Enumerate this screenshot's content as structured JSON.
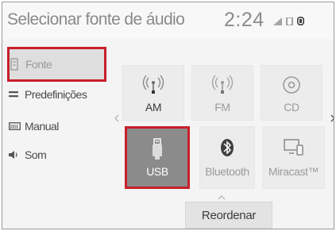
{
  "header": {
    "title": "Selecionar fonte de áudio",
    "clock": "2:24"
  },
  "sidebar": {
    "items": [
      {
        "label": "Fonte",
        "icon": "source-icon",
        "selected": true
      },
      {
        "label": "Predefinições",
        "icon": "presets-icon",
        "selected": false
      },
      {
        "label": "Manual",
        "icon": "manual-icon",
        "selected": false
      },
      {
        "label": "Som",
        "icon": "speaker-icon",
        "selected": false
      }
    ]
  },
  "sources": [
    {
      "label": "AM",
      "icon": "radio-wave-icon",
      "active": true
    },
    {
      "label": "FM",
      "icon": "radio-wave-icon",
      "active": false
    },
    {
      "label": "CD",
      "icon": "disc-icon",
      "active": false
    },
    {
      "label": "USB",
      "icon": "usb-icon",
      "active": true,
      "selected": true
    },
    {
      "label": "Bluetooth",
      "icon": "bluetooth-icon",
      "active": false
    },
    {
      "label": "Miracast™",
      "icon": "miracast-icon",
      "active": false
    }
  ],
  "actions": {
    "reorder_label": "Reordenar"
  },
  "colors": {
    "highlight": "#c8202a",
    "selected_tile": "#8b8b8b",
    "tile": "#ececec",
    "background": "#f4f4f4"
  }
}
